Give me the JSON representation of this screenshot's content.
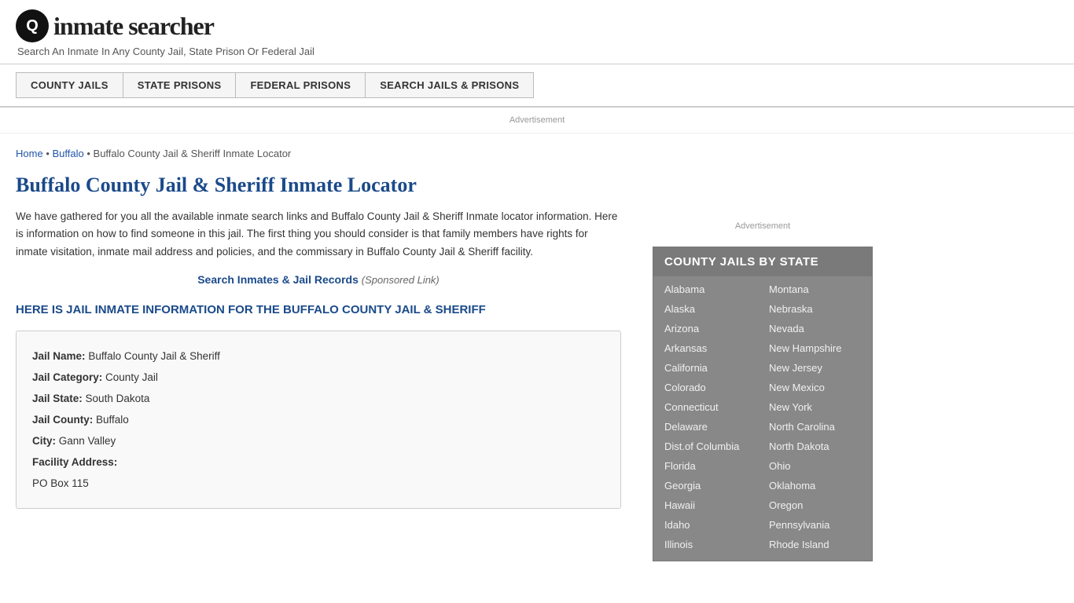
{
  "header": {
    "logo_icon": "🔍",
    "logo_text": "inmate searcher",
    "tagline": "Search An Inmate In Any County Jail, State Prison Or Federal Jail"
  },
  "nav": {
    "buttons": [
      {
        "label": "COUNTY JAILS",
        "id": "county-jails"
      },
      {
        "label": "STATE PRISONS",
        "id": "state-prisons"
      },
      {
        "label": "FEDERAL PRISONS",
        "id": "federal-prisons"
      },
      {
        "label": "SEARCH JAILS & PRISONS",
        "id": "search-jails"
      }
    ]
  },
  "ad": {
    "label": "Advertisement"
  },
  "breadcrumb": {
    "home": "Home",
    "parent": "Buffalo",
    "current": "Buffalo County Jail & Sheriff Inmate Locator"
  },
  "page_title": "Buffalo County Jail & Sheriff Inmate Locator",
  "description": "We have gathered for you all the available inmate search links and Buffalo County Jail & Sheriff Inmate locator information. Here is information on how to find someone in this jail. The first thing you should consider is that family members have rights for inmate visitation, inmate mail address and policies, and the commissary in Buffalo County Jail & Sheriff facility.",
  "sponsored": {
    "link_text": "Search Inmates & Jail Records",
    "note": "(Sponsored Link)"
  },
  "section_heading": "HERE IS JAIL INMATE INFORMATION FOR THE BUFFALO COUNTY JAIL & SHERIFF",
  "jail_info": {
    "name_label": "Jail Name:",
    "name_value": "Buffalo County Jail & Sheriff",
    "category_label": "Jail Category:",
    "category_value": "County Jail",
    "state_label": "Jail State:",
    "state_value": "South Dakota",
    "county_label": "Jail County:",
    "county_value": "Buffalo",
    "city_label": "City:",
    "city_value": "Gann Valley",
    "address_label": "Facility Address:",
    "address_value": "PO Box 115"
  },
  "sidebar": {
    "ad_label": "Advertisement",
    "county_jails_title": "COUNTY JAILS BY STATE",
    "states_col1": [
      "Alabama",
      "Alaska",
      "Arizona",
      "Arkansas",
      "California",
      "Colorado",
      "Connecticut",
      "Delaware",
      "Dist.of Columbia",
      "Florida",
      "Georgia",
      "Hawaii",
      "Idaho",
      "Illinois"
    ],
    "states_col2": [
      "Montana",
      "Nebraska",
      "Nevada",
      "New Hampshire",
      "New Jersey",
      "New Mexico",
      "New York",
      "North Carolina",
      "North Dakota",
      "Ohio",
      "Oklahoma",
      "Oregon",
      "Pennsylvania",
      "Rhode Island"
    ]
  }
}
